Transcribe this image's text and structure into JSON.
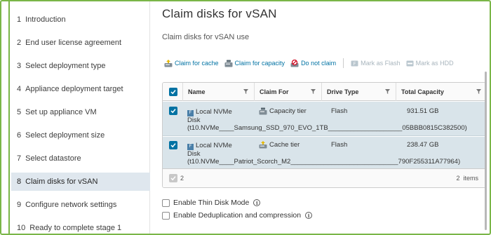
{
  "sidebar": {
    "steps": [
      {
        "num": "1",
        "label": "Introduction"
      },
      {
        "num": "2",
        "label": "End user license agreement"
      },
      {
        "num": "3",
        "label": "Select deployment type"
      },
      {
        "num": "4",
        "label": "Appliance deployment target"
      },
      {
        "num": "5",
        "label": "Set up appliance VM"
      },
      {
        "num": "6",
        "label": "Select deployment size"
      },
      {
        "num": "7",
        "label": "Select datastore"
      },
      {
        "num": "8",
        "label": "Claim disks for vSAN"
      },
      {
        "num": "9",
        "label": "Configure network settings"
      },
      {
        "num": "10",
        "label": "Ready to complete stage 1"
      }
    ],
    "active_step": "8"
  },
  "main": {
    "title": "Claim disks for vSAN",
    "subtitle": "Claim disks for vSAN use"
  },
  "toolbar": {
    "claim_cache": "Claim for cache",
    "claim_capacity": "Claim for capacity",
    "do_not_claim": "Do not claim",
    "mark_flash": "Mark as Flash",
    "mark_hdd": "Mark as HDD"
  },
  "grid": {
    "columns": [
      "Name",
      "Claim For",
      "Drive Type",
      "Total Capacity"
    ],
    "rows": [
      {
        "name_line1": "Local NVMe",
        "name_line2": "Disk",
        "name_id": "(t10.NVMe____Samsung_SSD_970_EVO_1TB____________________05BBB0815C382500)",
        "claim_for": "Capacity tier",
        "drive_type": "Flash",
        "capacity": "931.51 GB"
      },
      {
        "name_line1": "Local NVMe",
        "name_line2": "Disk",
        "name_id": "(t10.NVMe____Patriot_Scorch_M2_____________________________790F255311A77964)",
        "claim_for": "Cache tier",
        "drive_type": "Flash",
        "capacity": "238.47 GB"
      }
    ],
    "footer_selected": "2",
    "footer_items": "2  items"
  },
  "options": {
    "thin_disk": "Enable Thin Disk Mode",
    "dedup": "Enable Deduplication and compression"
  },
  "colors": {
    "accent_green": "#7ab648",
    "link_blue": "#0072a3",
    "selected_row": "#d9e4ea",
    "active_step": "#dfe7ee"
  }
}
